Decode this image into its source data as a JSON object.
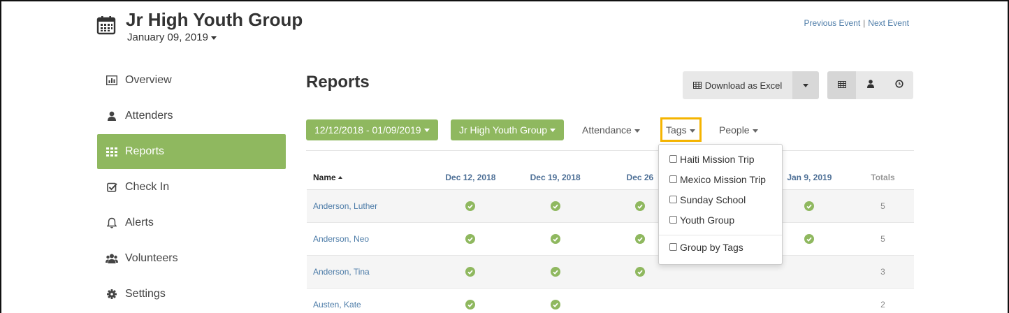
{
  "event": {
    "title": "Jr High Youth Group",
    "date": "January 09, 2019",
    "prev_label": "Previous Event",
    "separator": "|",
    "next_label": "Next Event"
  },
  "sidebar": {
    "items": [
      {
        "label": "Overview",
        "icon": "bar-chart-icon"
      },
      {
        "label": "Attenders",
        "icon": "user-icon"
      },
      {
        "label": "Reports",
        "icon": "grid-icon",
        "active": true
      },
      {
        "label": "Check In",
        "icon": "checkbox-icon"
      },
      {
        "label": "Alerts",
        "icon": "bell-icon"
      },
      {
        "label": "Volunteers",
        "icon": "users-icon"
      },
      {
        "label": "Settings",
        "icon": "gear-icon"
      }
    ]
  },
  "main": {
    "title": "Reports",
    "download_label": "Download as Excel"
  },
  "filters": {
    "date_range": "12/12/2018 - 01/09/2019",
    "group": "Jr High Youth Group",
    "attendance": "Attendance",
    "tags": "Tags",
    "people": "People"
  },
  "tags_menu": {
    "items": [
      "Haiti Mission Trip",
      "Mexico Mission Trip",
      "Sunday School",
      "Youth Group"
    ],
    "group_by": "Group by Tags"
  },
  "table": {
    "headers": {
      "name": "Name",
      "dates": [
        "Dec 12, 2018",
        "Dec 19, 2018",
        "Dec 26",
        "",
        "Jan 9, 2019"
      ],
      "totals": "Totals"
    },
    "rows": [
      {
        "name": "Anderson, Luther",
        "checks": [
          true,
          true,
          true,
          false,
          true
        ],
        "total": "5"
      },
      {
        "name": "Anderson, Neo",
        "checks": [
          true,
          true,
          true,
          false,
          true
        ],
        "total": "5"
      },
      {
        "name": "Anderson, Tina",
        "checks": [
          true,
          true,
          true,
          false,
          false
        ],
        "total": "3"
      },
      {
        "name": "Austen, Kate",
        "checks": [
          true,
          true,
          false,
          false,
          false
        ],
        "total": "2"
      }
    ]
  },
  "colors": {
    "accent": "#8fb85f",
    "highlight": "#f5b400",
    "link": "#4d7ca8"
  }
}
